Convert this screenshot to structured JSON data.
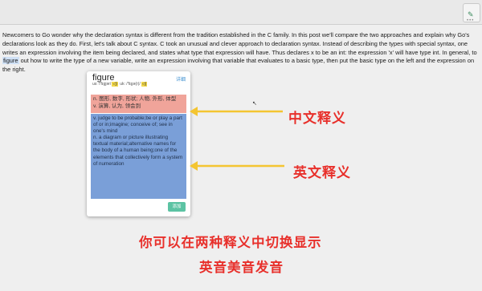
{
  "article": {
    "before_highlight": "Newcomers to Go wonder why the declaration syntax is different from the tradition established in the C family. In this post we'll compare the two approaches and explain why Go's declarations look as they do. First, let's talk about C syntax. C took an unusual and clever approach to declaration syntax. Instead of describing the types with special syntax, one writes an expression involving the item being declared, and states what type that expression will have. Thus declares x to be an int: the expression 'x' will have type int. In general, to",
    "highlight": "figure",
    "after_highlight": "out how to write the type of a new variable, write an expression involving that variable that evaluates to a basic type, then put the basic type on the left and the expression on the right."
  },
  "popup": {
    "word": "figure",
    "detail_label": "详细",
    "phon_us_label": "us: /'fɪɡjər/",
    "speaker_us": "◁)",
    "phon_uk_label": "uk: /'fɪɡə(r)/",
    "speaker_uk": "◁)",
    "def_cn_line1": "n. 图形, 数字, 形状; 人物, 外形, 体型",
    "def_cn_line2": "v. 演算, 认为, 领会到",
    "def_en_line1": "v. judge to be probable;be or play a part of or in;imagine; conceive of; see in one's mind",
    "def_en_line2": "n. a diagram or picture illustrating textual material;alternative names for the body of a human being;one of the elements that collectively form a system of numeration",
    "add_label": "添加"
  },
  "annotations": {
    "cn_def_label": "中文释义",
    "en_def_label": "英文释义",
    "bottom_line1": "你可以在两种释义中切换显示",
    "bottom_line2": "英音美音发音"
  },
  "colors": {
    "annotation": "#e8302b",
    "arrow": "#f4c531",
    "cn_def_bg": "#f0a49a",
    "en_def_bg": "#7a9fd8",
    "add_button": "#5cc3a3"
  }
}
